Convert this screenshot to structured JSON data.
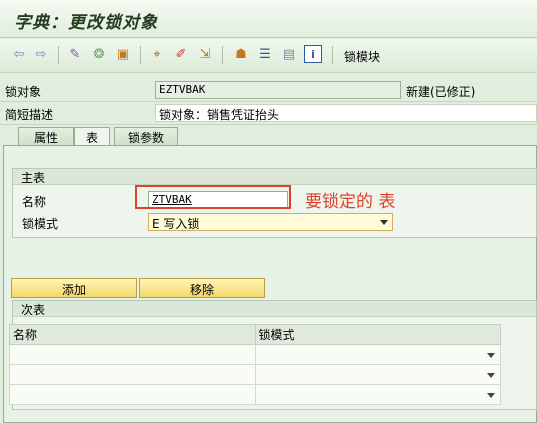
{
  "window": {
    "title": "字典：更改锁对象"
  },
  "toolbar": {
    "lock_module_label": "锁模块"
  },
  "header_fields": {
    "lock_object_label": "锁对象",
    "lock_object_value": "EZTVBAK",
    "lock_object_status": "新建(已修正)",
    "short_desc_label": "简短描述",
    "short_desc_value": "锁对象：销售凭证抬头"
  },
  "tabs": [
    {
      "label": "属性"
    },
    {
      "label": "表"
    },
    {
      "label": "锁参数"
    }
  ],
  "primary_table": {
    "group_title": "主表",
    "name_label": "名称",
    "name_value": "ZTVBAK",
    "lock_mode_label": "锁模式",
    "lock_mode_value": "E 写入锁",
    "annotation": "要锁定的 表"
  },
  "buttons": {
    "add_label": "添加",
    "remove_label": "移除"
  },
  "secondary_table": {
    "group_title": "次表",
    "columns": [
      "名称",
      "锁模式"
    ]
  },
  "colors": {
    "annotation_red": "#e0402c",
    "background_green": "#dfeedd"
  }
}
